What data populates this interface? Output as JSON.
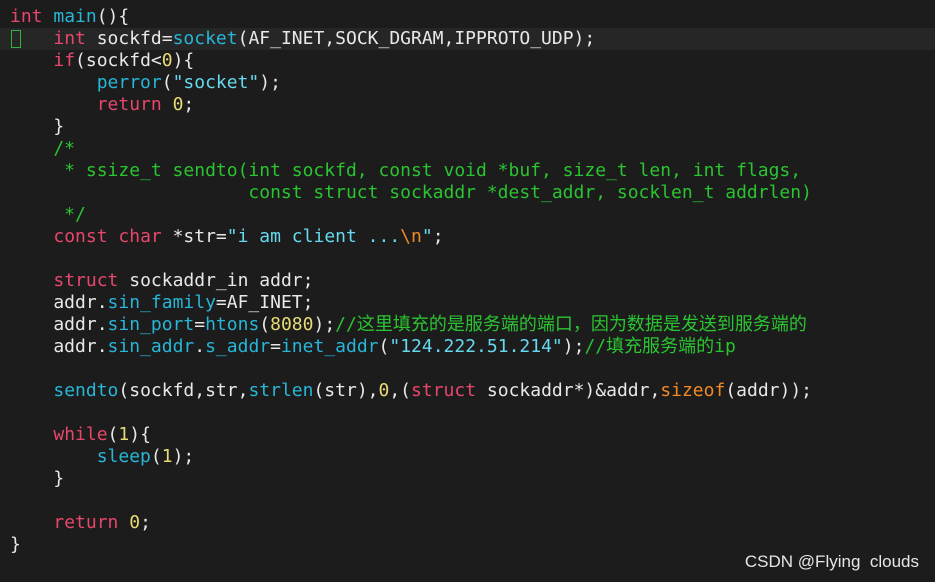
{
  "theme": {
    "background": "#1c1c1c",
    "colors": {
      "plain": "#e8e8e8",
      "keyword": "#e8476b",
      "type": "#e8476b",
      "function": "#27b6d8",
      "comment": "#2bc431",
      "string": "#66d9ef",
      "number": "#e6db74",
      "orange": "#f08a24",
      "cursor": "#2db43b"
    }
  },
  "editor": {
    "cursor_line_index": 1,
    "lines": [
      [
        {
          "t": "int",
          "c": "keyword"
        },
        {
          "t": " ",
          "c": "plain"
        },
        {
          "t": "main",
          "c": "function"
        },
        {
          "t": "(){",
          "c": "plain"
        }
      ],
      [
        {
          "t": "    ",
          "c": "plain"
        },
        {
          "t": "int",
          "c": "keyword"
        },
        {
          "t": " sockfd=",
          "c": "plain"
        },
        {
          "t": "socket",
          "c": "function"
        },
        {
          "t": "(AF_INET,SOCK_DGRAM,IPPROTO_UDP);",
          "c": "plain"
        }
      ],
      [
        {
          "t": "    ",
          "c": "plain"
        },
        {
          "t": "if",
          "c": "keyword"
        },
        {
          "t": "(sockfd<",
          "c": "plain"
        },
        {
          "t": "0",
          "c": "number"
        },
        {
          "t": "){",
          "c": "plain"
        }
      ],
      [
        {
          "t": "        ",
          "c": "plain"
        },
        {
          "t": "perror",
          "c": "function"
        },
        {
          "t": "(",
          "c": "plain"
        },
        {
          "t": "\"socket\"",
          "c": "string"
        },
        {
          "t": ");",
          "c": "plain"
        }
      ],
      [
        {
          "t": "        ",
          "c": "plain"
        },
        {
          "t": "return",
          "c": "keyword"
        },
        {
          "t": " ",
          "c": "plain"
        },
        {
          "t": "0",
          "c": "number"
        },
        {
          "t": ";",
          "c": "plain"
        }
      ],
      [
        {
          "t": "    }",
          "c": "plain"
        }
      ],
      [
        {
          "t": "    /*",
          "c": "comment"
        }
      ],
      [
        {
          "t": "     * ssize_t sendto(int sockfd, const void *buf, size_t len, int flags,",
          "c": "comment"
        }
      ],
      [
        {
          "t": "                      const struct sockaddr *dest_addr, socklen_t addrlen)",
          "c": "comment"
        }
      ],
      [
        {
          "t": "     */",
          "c": "comment"
        }
      ],
      [
        {
          "t": "    ",
          "c": "plain"
        },
        {
          "t": "const",
          "c": "keyword"
        },
        {
          "t": " ",
          "c": "plain"
        },
        {
          "t": "char",
          "c": "keyword"
        },
        {
          "t": " *str=",
          "c": "plain"
        },
        {
          "t": "\"i am client ...",
          "c": "string"
        },
        {
          "t": "\\n",
          "c": "orange"
        },
        {
          "t": "\"",
          "c": "string"
        },
        {
          "t": ";",
          "c": "plain"
        }
      ],
      [
        {
          "t": "",
          "c": "plain"
        }
      ],
      [
        {
          "t": "    ",
          "c": "plain"
        },
        {
          "t": "struct",
          "c": "keyword"
        },
        {
          "t": " sockaddr_in addr;",
          "c": "plain"
        }
      ],
      [
        {
          "t": "    addr.",
          "c": "plain"
        },
        {
          "t": "sin_family",
          "c": "function"
        },
        {
          "t": "=AF_INET;",
          "c": "plain"
        }
      ],
      [
        {
          "t": "    addr.",
          "c": "plain"
        },
        {
          "t": "sin_port",
          "c": "function"
        },
        {
          "t": "=",
          "c": "plain"
        },
        {
          "t": "htons",
          "c": "function"
        },
        {
          "t": "(",
          "c": "plain"
        },
        {
          "t": "8080",
          "c": "number"
        },
        {
          "t": ");",
          "c": "plain"
        },
        {
          "t": "//这里填充的是服务端的端口，因为数据是发送到服务端的",
          "c": "comment"
        }
      ],
      [
        {
          "t": "    addr.",
          "c": "plain"
        },
        {
          "t": "sin_addr",
          "c": "function"
        },
        {
          "t": ".",
          "c": "plain"
        },
        {
          "t": "s_addr",
          "c": "function"
        },
        {
          "t": "=",
          "c": "plain"
        },
        {
          "t": "inet_addr",
          "c": "function"
        },
        {
          "t": "(",
          "c": "plain"
        },
        {
          "t": "\"124.222.51.214\"",
          "c": "string"
        },
        {
          "t": ");",
          "c": "plain"
        },
        {
          "t": "//填充服务端的ip",
          "c": "comment"
        }
      ],
      [
        {
          "t": "",
          "c": "plain"
        }
      ],
      [
        {
          "t": "    ",
          "c": "plain"
        },
        {
          "t": "sendto",
          "c": "function"
        },
        {
          "t": "(sockfd,str,",
          "c": "plain"
        },
        {
          "t": "strlen",
          "c": "function"
        },
        {
          "t": "(str),",
          "c": "plain"
        },
        {
          "t": "0",
          "c": "number"
        },
        {
          "t": ",(",
          "c": "plain"
        },
        {
          "t": "struct",
          "c": "keyword"
        },
        {
          "t": " sockaddr*)&addr,",
          "c": "plain"
        },
        {
          "t": "sizeof",
          "c": "orange"
        },
        {
          "t": "(addr));",
          "c": "plain"
        }
      ],
      [
        {
          "t": "",
          "c": "plain"
        }
      ],
      [
        {
          "t": "    ",
          "c": "plain"
        },
        {
          "t": "while",
          "c": "keyword"
        },
        {
          "t": "(",
          "c": "plain"
        },
        {
          "t": "1",
          "c": "number"
        },
        {
          "t": "){",
          "c": "plain"
        }
      ],
      [
        {
          "t": "        ",
          "c": "plain"
        },
        {
          "t": "sleep",
          "c": "function"
        },
        {
          "t": "(",
          "c": "plain"
        },
        {
          "t": "1",
          "c": "number"
        },
        {
          "t": ");",
          "c": "plain"
        }
      ],
      [
        {
          "t": "    }",
          "c": "plain"
        }
      ],
      [
        {
          "t": "",
          "c": "plain"
        }
      ],
      [
        {
          "t": "    ",
          "c": "plain"
        },
        {
          "t": "return",
          "c": "keyword"
        },
        {
          "t": " ",
          "c": "plain"
        },
        {
          "t": "0",
          "c": "number"
        },
        {
          "t": ";",
          "c": "plain"
        }
      ],
      [
        {
          "t": "}",
          "c": "plain"
        }
      ]
    ]
  },
  "watermark": "CSDN @Flying  clouds"
}
